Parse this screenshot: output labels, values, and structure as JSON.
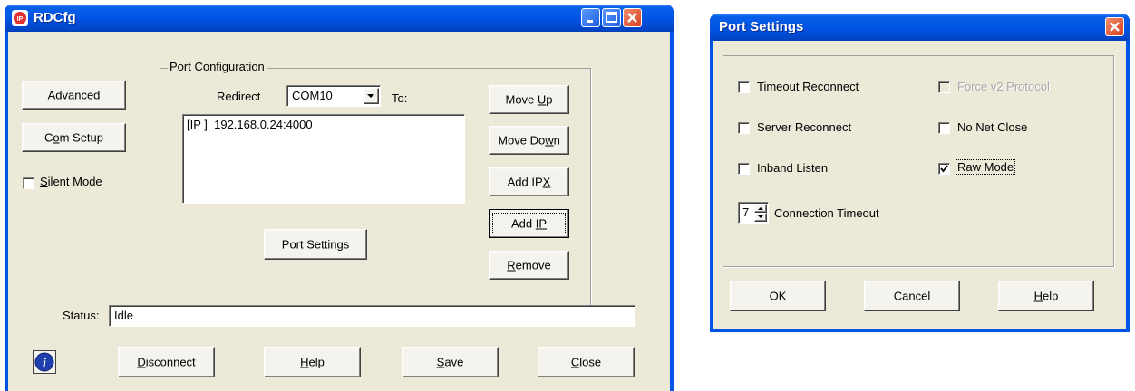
{
  "main_window": {
    "title": "RDCfg",
    "buttons": {
      "advanced": "Advanced",
      "com_setup": "Com Setup",
      "move_up": "Move Up",
      "move_down": "Move Down",
      "add_ipx": "Add IPX",
      "add_ip": "Add IP",
      "remove": "Remove",
      "port_settings": "Port Settings",
      "disconnect": "Disconnect",
      "help": "Help",
      "save": "Save",
      "close": "Close"
    },
    "silent_mode": {
      "label": "Silent Mode",
      "checked": false
    },
    "port_configuration": {
      "group_label": "Port Configuration",
      "redirect_label": "Redirect",
      "redirect_value": "COM10",
      "to_label": "To:",
      "list_items": [
        "[IP ]  192.168.0.24:4000"
      ]
    },
    "status": {
      "label": "Status:",
      "value": "Idle"
    }
  },
  "port_settings_dialog": {
    "title": "Port Settings",
    "options": {
      "timeout_reconnect": {
        "label": "Timeout Reconnect",
        "checked": false,
        "enabled": true
      },
      "force_v2_protocol": {
        "label": "Force v2 Protocol",
        "checked": false,
        "enabled": false
      },
      "server_reconnect": {
        "label": "Server Reconnect",
        "checked": false,
        "enabled": true
      },
      "no_net_close": {
        "label": "No Net Close",
        "checked": false,
        "enabled": true
      },
      "inband_listen": {
        "label": "Inband Listen",
        "checked": false,
        "enabled": true
      },
      "raw_mode": {
        "label": "Raw Mode",
        "checked": true,
        "enabled": true
      }
    },
    "connection_timeout": {
      "value": "7",
      "label": "Connection Timeout"
    },
    "buttons": {
      "ok": "OK",
      "cancel": "Cancel",
      "help": "Help"
    }
  },
  "colors": {
    "titlebar_blue": "#0054e3",
    "client_bg": "#ece9d8",
    "close_red": "#d8421f"
  }
}
